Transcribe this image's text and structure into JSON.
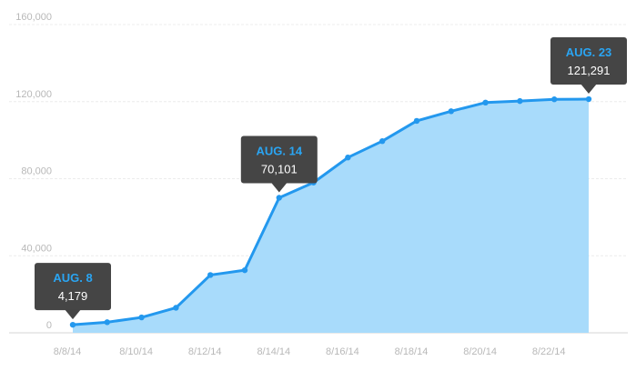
{
  "colors": {
    "area_fill": "#a8dbfb",
    "line": "#2398ee",
    "point": "#2398ee",
    "callout_bg": "#454545",
    "callout_date": "#2aa5f3",
    "callout_value": "#ffffff"
  },
  "chart_data": {
    "type": "area",
    "title": "",
    "xlabel": "",
    "ylabel": "",
    "ylim": [
      0,
      160000
    ],
    "y_ticks": [
      {
        "value": 0,
        "label": "0"
      },
      {
        "value": 40000,
        "label": "40,000"
      },
      {
        "value": 80000,
        "label": "80,000"
      },
      {
        "value": 120000,
        "label": "120,000"
      },
      {
        "value": 160000,
        "label": "160,000"
      }
    ],
    "x_dates": [
      "8/8/14",
      "8/9/14",
      "8/10/14",
      "8/11/14",
      "8/12/14",
      "8/13/14",
      "8/14/14",
      "8/15/14",
      "8/16/14",
      "8/17/14",
      "8/18/14",
      "8/19/14",
      "8/20/14",
      "8/21/14",
      "8/22/14",
      "8/23/14"
    ],
    "x_tick_labels": [
      "8/8/14",
      "8/10/14",
      "8/12/14",
      "8/14/14",
      "8/16/14",
      "8/18/14",
      "8/20/14",
      "8/22/14"
    ],
    "series": [
      {
        "values": [
          4179,
          5500,
          8000,
          13000,
          30000,
          32500,
          70101,
          78000,
          91000,
          99500,
          110000,
          115000,
          119500,
          120300,
          121200,
          121291
        ]
      }
    ],
    "grid": true,
    "annotations": [
      {
        "date_index": 0,
        "label": "AUG. 8",
        "value_text": "4,179"
      },
      {
        "date_index": 6,
        "label": "AUG. 14",
        "value_text": "70,101"
      },
      {
        "date_index": 15,
        "label": "AUG. 23",
        "value_text": "121,291"
      }
    ]
  }
}
